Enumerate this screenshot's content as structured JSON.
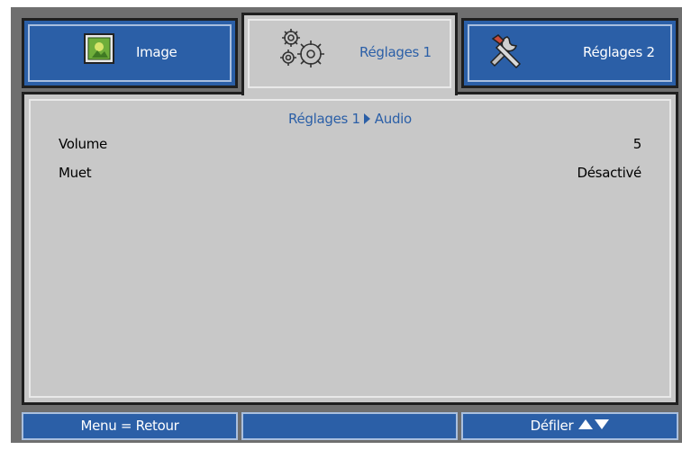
{
  "tabs": [
    {
      "label": "Image",
      "icon": "image-icon"
    },
    {
      "label": "Réglages 1",
      "icon": "gears-icon"
    },
    {
      "label": "Réglages 2",
      "icon": "tools-icon"
    }
  ],
  "active_tab": 1,
  "breadcrumb": {
    "section": "Réglages 1",
    "page": "Audio"
  },
  "settings": [
    {
      "label": "Volume",
      "value": "5"
    },
    {
      "label": "Muet",
      "value": "Désactivé"
    }
  ],
  "footer": {
    "back_hint": "Menu = Retour",
    "middle": "",
    "scroll_hint": "Défiler"
  },
  "colors": {
    "frame": "#6f6f6f",
    "tab_blue": "#2b5fa7",
    "panel": "#c8c8c8",
    "border_dark": "#1f1f1f",
    "accent_text": "#2b5fa7"
  }
}
